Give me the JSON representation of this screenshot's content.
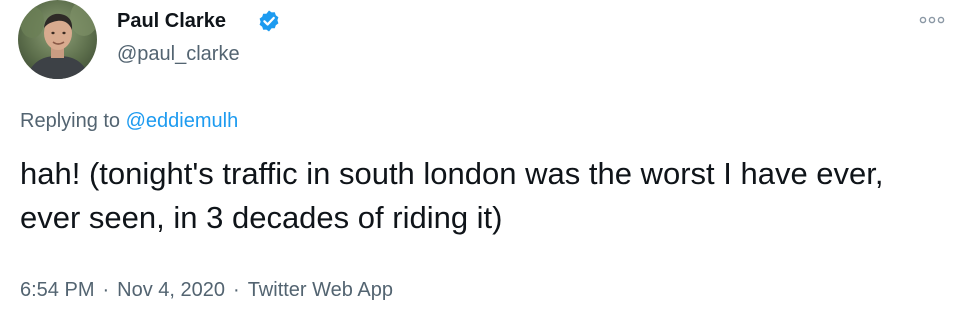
{
  "author": {
    "display_name": "Paul Clarke",
    "handle": "@paul_clarke",
    "verified": true,
    "verified_icon": "verified-badge-icon"
  },
  "reply_context": {
    "prefix": "Replying to",
    "mention": "@eddiemulh"
  },
  "tweet": {
    "text": "hah! (tonight's traffic in south london was the worst I have ever, ever seen, in 3 decades of riding it)"
  },
  "meta": {
    "time": "6:54 PM",
    "separator": "·",
    "date": "Nov 4, 2020",
    "source": "Twitter Web App"
  },
  "colors": {
    "accent": "#1d9bf0",
    "secondary_text": "#536471",
    "primary_text": "#0f1419"
  }
}
